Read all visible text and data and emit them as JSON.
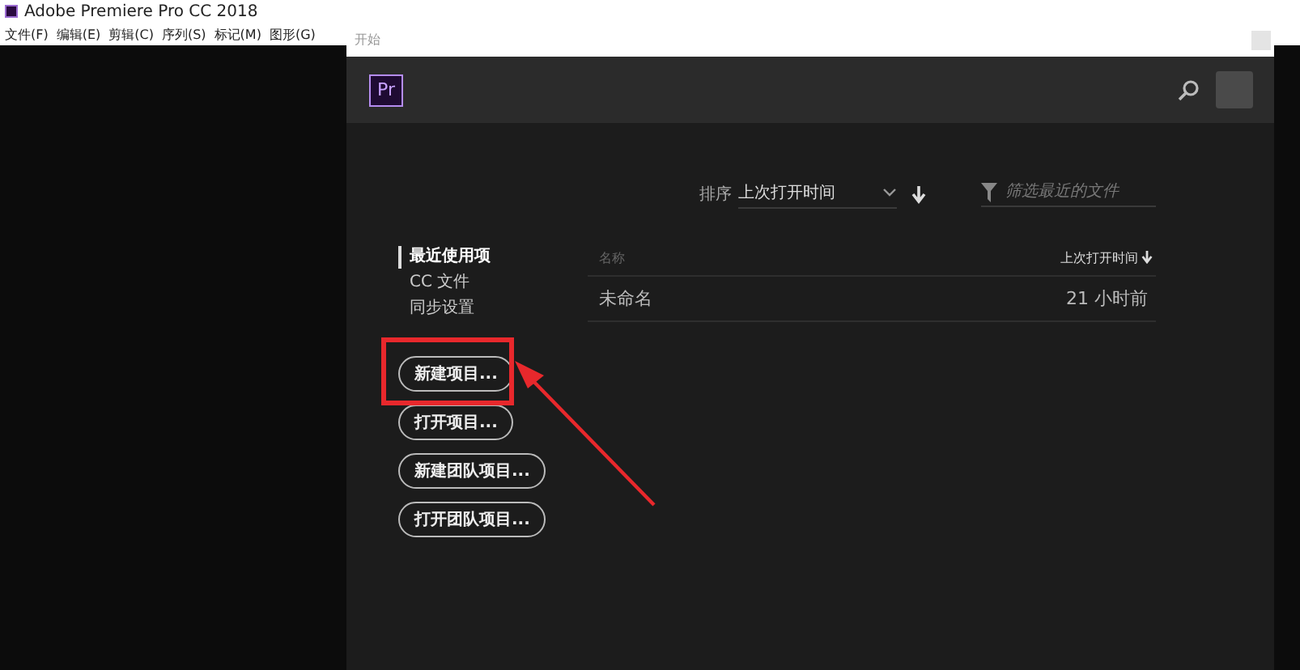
{
  "app": {
    "title": "Adobe Premiere Pro CC 2018",
    "menu": [
      "文件(F)",
      "编辑(E)",
      "剪辑(C)",
      "序列(S)",
      "标记(M)",
      "图形(G)"
    ]
  },
  "dialog": {
    "title": "开始",
    "logo": "Pr",
    "sort": {
      "label": "排序",
      "value": "上次打开时间"
    },
    "filter": {
      "placeholder": "筛选最近的文件"
    },
    "nav": [
      {
        "label": "最近使用项",
        "selected": true
      },
      {
        "label": "CC 文件",
        "selected": false
      },
      {
        "label": "同步设置",
        "selected": false
      }
    ],
    "buttons": [
      "新建项目...",
      "打开项目...",
      "新建团队项目...",
      "打开团队项目..."
    ],
    "table": {
      "columns": [
        "名称",
        "上次打开时间"
      ],
      "rows": [
        {
          "name": "未命名",
          "time": "21 小时前"
        }
      ]
    }
  }
}
